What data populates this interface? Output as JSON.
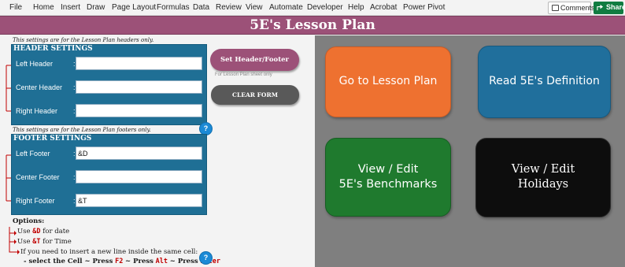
{
  "menu": [
    "File",
    "Home",
    "Insert",
    "Draw",
    "Page Layout",
    "Formulas",
    "Data",
    "Review",
    "View",
    "Automate",
    "Developer",
    "Help",
    "Acrobat",
    "Power Pivot"
  ],
  "actions": {
    "comments": "Comments",
    "share": "Share"
  },
  "title": "5E's Lesson Plan",
  "header_note": "This settings are for the Lesson Plan headers only.",
  "header_settings": {
    "title": "HEADER SETTINGS",
    "rows": [
      {
        "label": "Left Header",
        "value": ""
      },
      {
        "label": "Center Header",
        "value": ""
      },
      {
        "label": "Right Header",
        "value": ""
      }
    ]
  },
  "footer_note": "This settings are for the Lesson Plan footers only.",
  "footer_settings": {
    "title": "FOOTER SETTINGS",
    "rows": [
      {
        "label": "Left Footer",
        "value": "&D"
      },
      {
        "label": "Center Footer",
        "value": ""
      },
      {
        "label": "Right Footer",
        "value": "&T"
      }
    ]
  },
  "colon": ":",
  "help_glyph": "?",
  "buttons": {
    "set_header_footer": "Set Header/Footer",
    "set_note": "For Lesson Plan sheet only",
    "clear_form": "CLEAR FORM"
  },
  "options": {
    "title": "Options:",
    "use": "Use",
    "date_code": "&D",
    "for_date": "for date",
    "time_code": "&T",
    "for_time": "for Time",
    "newline_note": "If you need to insert a new line inside the same cell:",
    "steps_prefix": "- select the Cell ~ Press",
    "key_f2": "F2",
    "press": "~ Press",
    "key_alt": "Alt",
    "key_enter": "Enter"
  },
  "tiles": {
    "lesson": "Go to Lesson Plan",
    "define": "Read 5E's Definition",
    "bench_line1": "View / Edit",
    "bench_line2": "5E's Benchmarks",
    "holiday_line1": "View / Edit",
    "holiday_line2": "Holidays"
  },
  "colors": {
    "title_bar": "#9c5178",
    "settings_panel": "#1f6f95",
    "nav_panel": "#7f7f7f",
    "tile_lesson": "#ee7130",
    "tile_define": "#206f9c",
    "tile_bench": "#1f7a2e",
    "tile_holiday": "#0d0d0d",
    "connector": "#c00000"
  }
}
